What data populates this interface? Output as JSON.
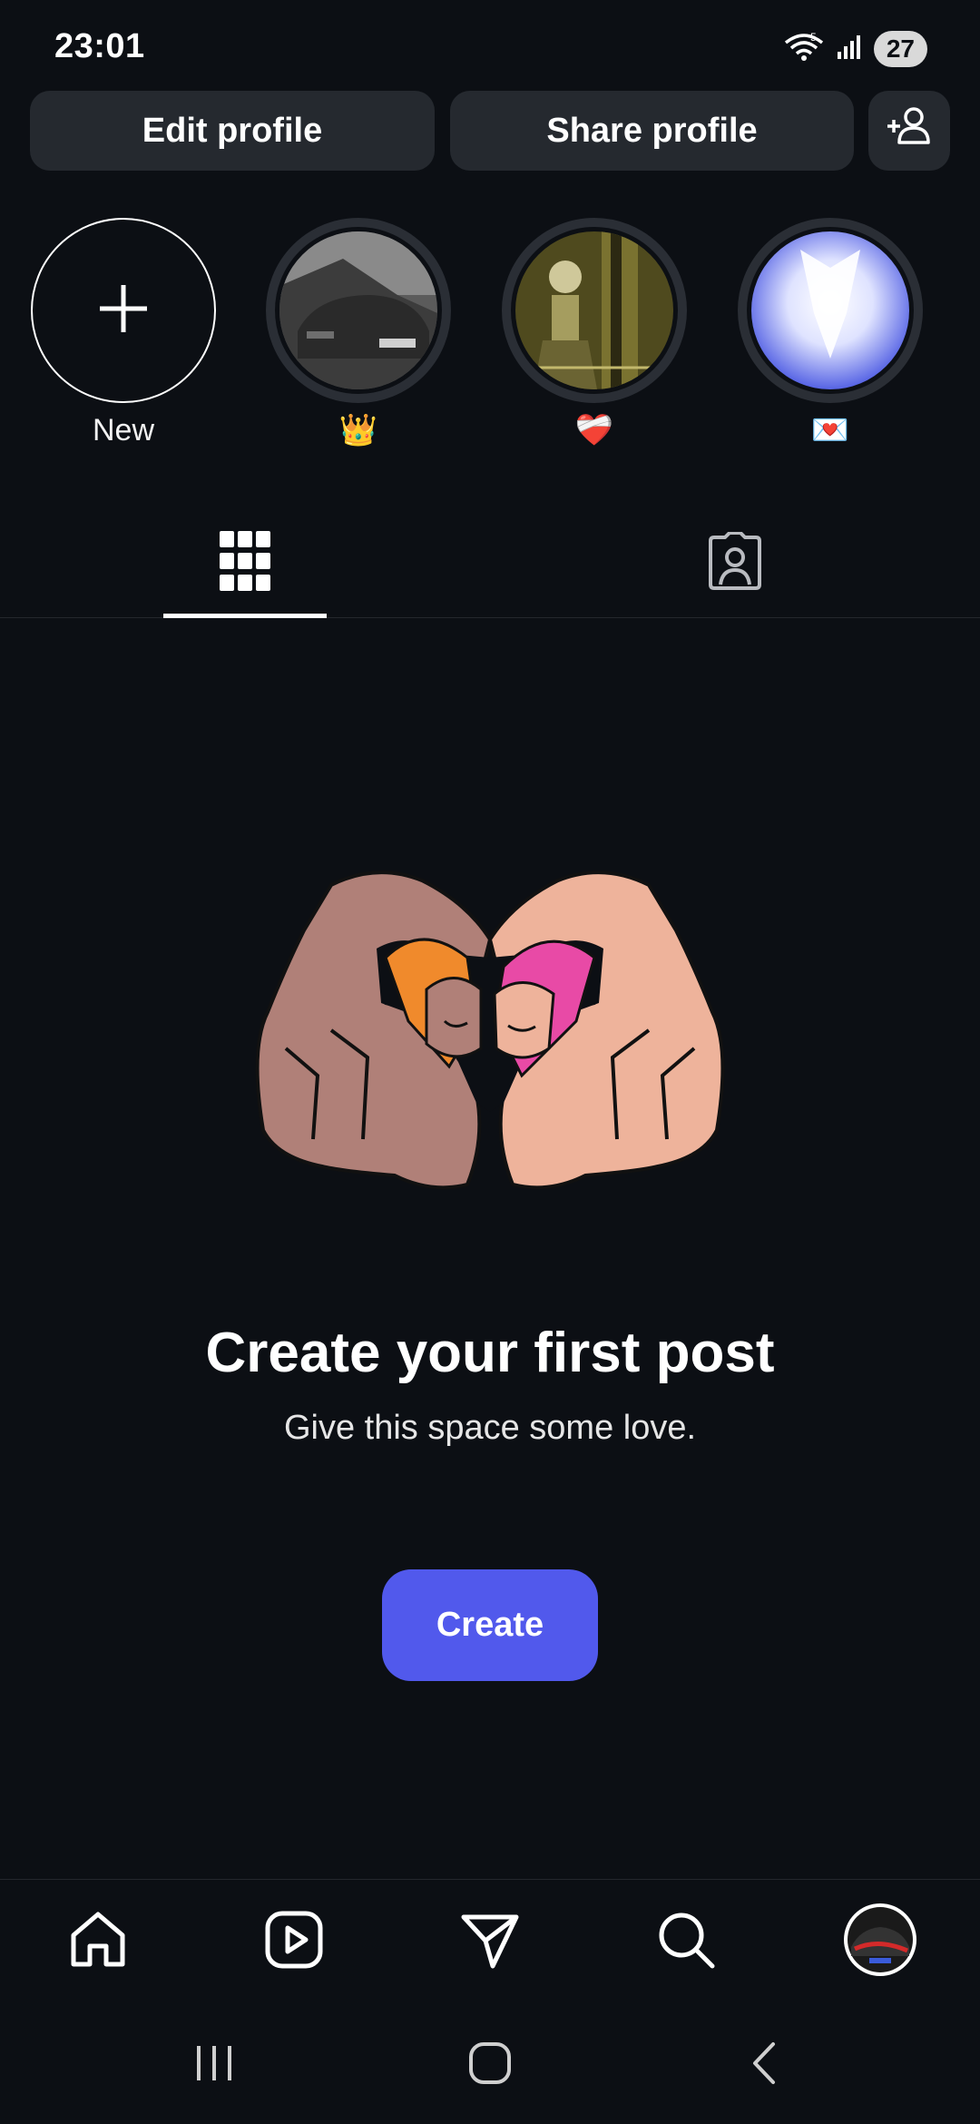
{
  "status_bar": {
    "time": "23:01",
    "battery": "27",
    "network": "5"
  },
  "profile_actions": {
    "edit_label": "Edit profile",
    "share_label": "Share profile",
    "add_person_icon": "add-person-icon"
  },
  "highlights": [
    {
      "label": "New",
      "type": "new"
    },
    {
      "label": "👑",
      "type": "story"
    },
    {
      "label": "❤️‍🩹",
      "type": "story"
    },
    {
      "label": "💌",
      "type": "story"
    }
  ],
  "tabs": [
    {
      "name": "grid",
      "icon": "grid-icon",
      "active": true
    },
    {
      "name": "tagged",
      "icon": "tagged-person-icon",
      "active": false
    }
  ],
  "empty_state": {
    "title": "Create your first post",
    "subtitle": "Give this space some love.",
    "button_label": "Create"
  },
  "bottom_nav": [
    {
      "name": "home",
      "icon": "home-icon"
    },
    {
      "name": "reels",
      "icon": "reels-icon"
    },
    {
      "name": "messages",
      "icon": "send-icon"
    },
    {
      "name": "search",
      "icon": "search-icon"
    },
    {
      "name": "profile",
      "icon": "profile-avatar"
    }
  ],
  "colors": {
    "background": "#0c0f14",
    "button_bg": "#25292f",
    "accent": "#5159ec"
  }
}
